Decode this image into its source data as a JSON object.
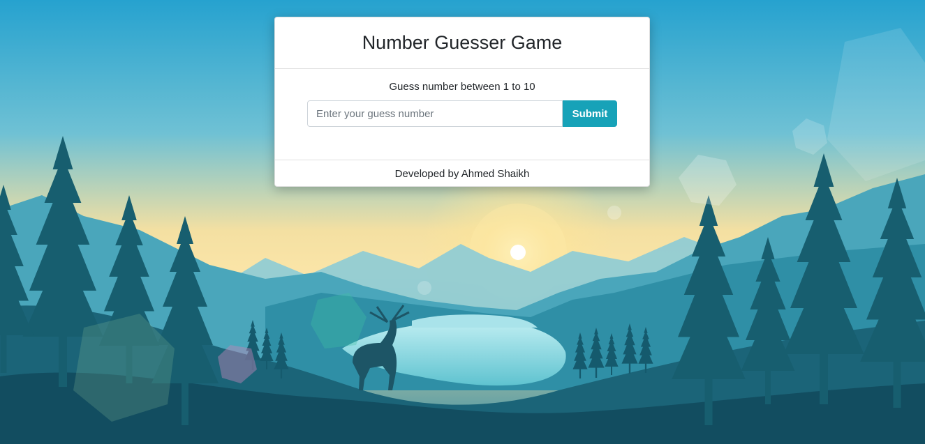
{
  "game": {
    "title": "Number Guesser Game",
    "instructions": "Guess number between 1 to 10",
    "input": {
      "value": "",
      "placeholder": "Enter your guess number"
    },
    "submit_label": "Submit",
    "footer": "Developed by Ahmed Shaikh"
  },
  "colors": {
    "accent": "#17a2b8",
    "sky_top": "#27a3cf",
    "sun": "#fde7a2",
    "forest_dark": "#0f4a5c",
    "lake": "#9fe0ea"
  },
  "background": {
    "icon": "forest-landscape-illustration"
  }
}
